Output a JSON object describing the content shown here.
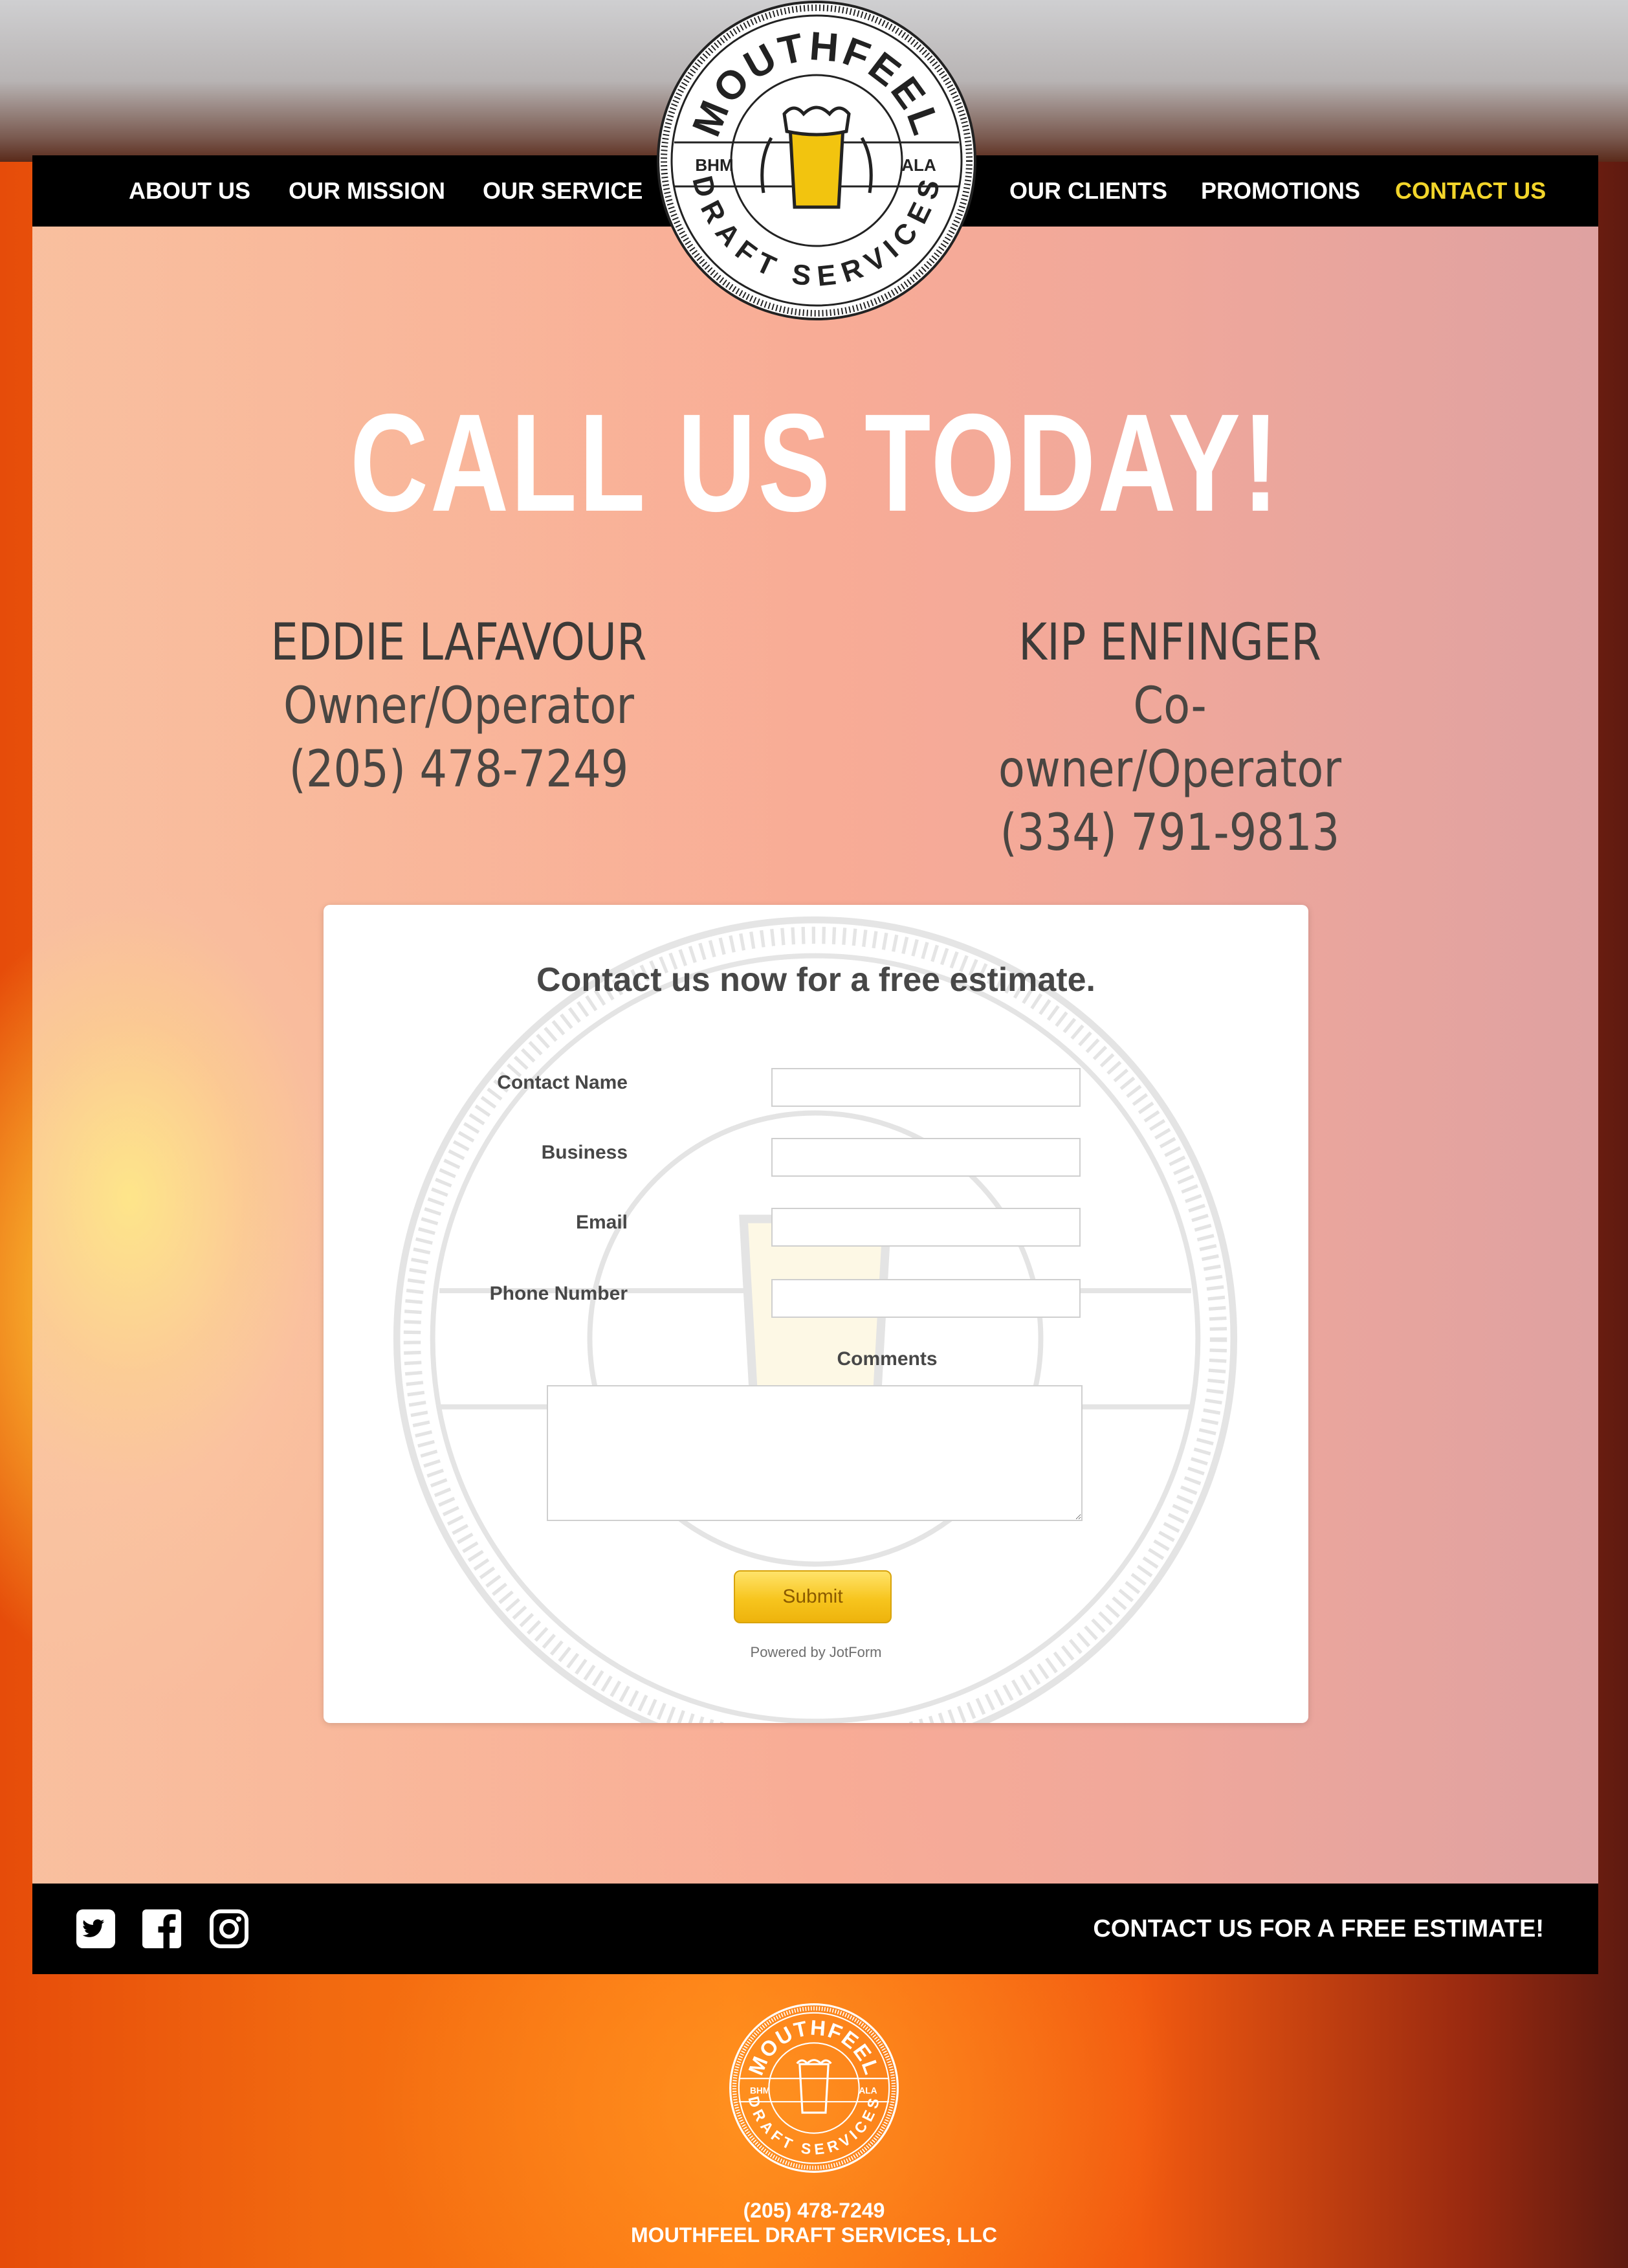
{
  "nav": {
    "items": [
      {
        "label": "ABOUT US",
        "active": false
      },
      {
        "label": "OUR MISSION",
        "active": false
      },
      {
        "label": "OUR SERVICE",
        "active": false
      },
      {
        "label": "OUR CLIENTS",
        "active": false
      },
      {
        "label": "PROMOTIONS",
        "active": false
      },
      {
        "label": "CONTACT US",
        "active": true
      }
    ],
    "active_color": "#f2d52a"
  },
  "logo": {
    "top_text": "MOUTHFEEL",
    "bottom_text": "DRAFT SERVICES",
    "left_text": "BHM",
    "right_text": "ALA"
  },
  "hero": {
    "title": "CALL US TODAY!"
  },
  "contacts": [
    {
      "name": "EDDIE LAFAVOUR",
      "role": "Owner/Operator",
      "phone": "(205) 478-7249"
    },
    {
      "name": "KIP ENFINGER",
      "role": "Co-owner/Operator",
      "phone": "(334) 791-9813"
    }
  ],
  "form": {
    "title": "Contact us now for a free estimate.",
    "fields": [
      {
        "label": "Contact Name",
        "value": ""
      },
      {
        "label": "Business",
        "value": ""
      },
      {
        "label": "Email",
        "value": ""
      },
      {
        "label": "Phone Number",
        "value": ""
      }
    ],
    "comments_label": "Comments",
    "comments_value": "",
    "submit_label": "Submit",
    "powered_by": "Powered by JotForm"
  },
  "footer": {
    "social": [
      "twitter-icon",
      "facebook-icon",
      "instagram-icon"
    ],
    "cta": "CONTACT US FOR A FREE ESTIMATE!",
    "phone": "(205) 478-7249",
    "company": "MOUTHFEEL DRAFT SERVICES, LLC"
  },
  "colors": {
    "brand_yellow": "#f2d52a",
    "nav_bg": "#000000",
    "submit_yellow": "#f7c51e"
  }
}
